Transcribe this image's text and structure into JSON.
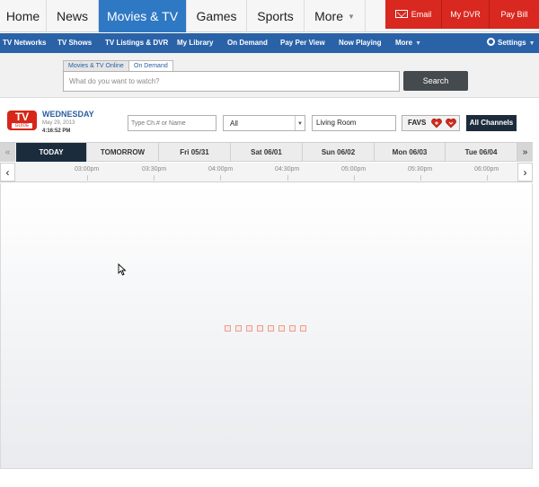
{
  "topnav": {
    "items": [
      {
        "label": "Home"
      },
      {
        "label": "News"
      },
      {
        "label": "Movies & TV",
        "active": true
      },
      {
        "label": "Games"
      },
      {
        "label": "Sports"
      },
      {
        "label": "More"
      }
    ],
    "actions": {
      "email": "Email",
      "dvr": "My DVR",
      "paybill": "Pay Bill"
    }
  },
  "subnav": {
    "items": [
      "TV Networks",
      "TV Shows",
      "TV Listings & DVR",
      "My Library",
      "On Demand",
      "Pay Per View",
      "Now Playing",
      "More"
    ],
    "settings": "Settings"
  },
  "search": {
    "tabs": [
      "Movies & TV Online",
      "On Demand"
    ],
    "active_tab": "On Demand",
    "placeholder": "What do you want to watch?",
    "button": "Search"
  },
  "guide": {
    "logo_big": "TV",
    "logo_small": "GUIDE",
    "day": "WEDNESDAY",
    "date": "May 29, 2013",
    "time": "4:16:52 PM",
    "channel_placeholder": "Type Ch.# or Name",
    "filter_value": "All",
    "room": "Living Room",
    "favs": "FAVS",
    "all_channels": "All Channels",
    "day_tabs": [
      "TODAY",
      "TOMORROW",
      "Fri 05/31",
      "Sat 06/01",
      "Sun 06/02",
      "Mon 06/03",
      "Tue 06/04"
    ],
    "times": [
      "03:00pm",
      "03:30pm",
      "04:00pm",
      "04:30pm",
      "05:00pm",
      "05:30pm",
      "06:00pm"
    ]
  },
  "colors": {
    "accent": "#2f78c3",
    "subnav": "#2a62a8",
    "red": "#d9281f",
    "dark": "#1b2c3d"
  }
}
